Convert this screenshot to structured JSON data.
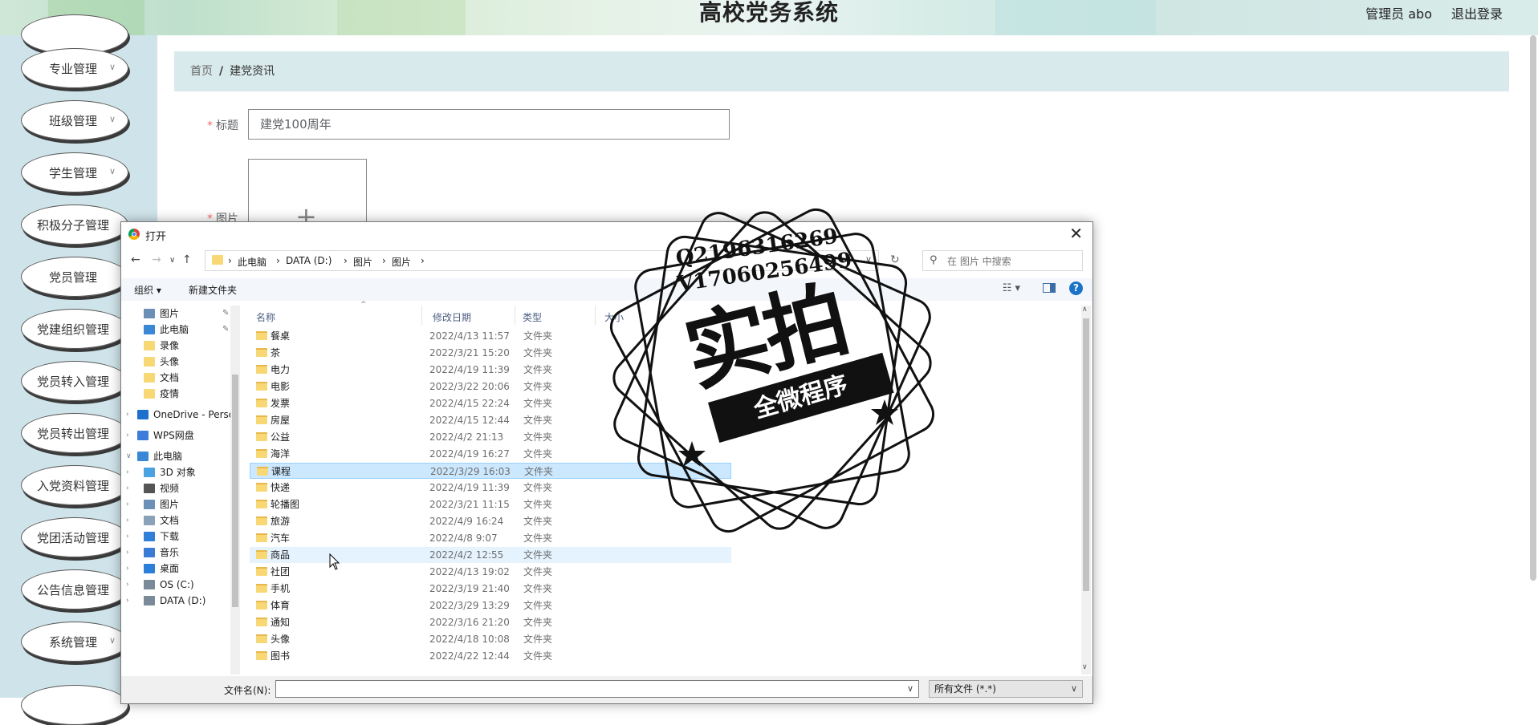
{
  "header": {
    "title": "高校党务系统",
    "user": "管理员 abo",
    "logout": "退出登录"
  },
  "sidebar": {
    "items": [
      {
        "label": "专业管理"
      },
      {
        "label": "班级管理"
      },
      {
        "label": "学生管理"
      },
      {
        "label": "积极分子管理"
      },
      {
        "label": "党员管理"
      },
      {
        "label": "党建组织管理"
      },
      {
        "label": "党员转入管理"
      },
      {
        "label": "党员转出管理"
      },
      {
        "label": "入党资料管理"
      },
      {
        "label": "党团活动管理"
      },
      {
        "label": "公告信息管理"
      },
      {
        "label": "系统管理"
      }
    ]
  },
  "breadcrumb": {
    "home": "首页",
    "separator": "/",
    "current": "建党资讯"
  },
  "form": {
    "title_label": "标题",
    "title_value": "建党100周年",
    "image_label": "图片",
    "required_mark": "*",
    "upload_plus": "+"
  },
  "dialog": {
    "title": "打开",
    "close": "✕",
    "path": [
      "此电脑",
      "DATA (D:)",
      "图片",
      "图片"
    ],
    "search_placeholder": "在 图片 中搜索",
    "toolbar": {
      "organize": "组织 ▾",
      "new_folder": "新建文件夹",
      "help": "?"
    },
    "tree": [
      {
        "label": "图片",
        "icon": "pictures-icon",
        "pinned": true
      },
      {
        "label": "此电脑",
        "icon": "computer-icon",
        "pinned": true
      },
      {
        "label": "录像",
        "icon": "folder-icon"
      },
      {
        "label": "头像",
        "icon": "folder-icon"
      },
      {
        "label": "文档",
        "icon": "folder-icon"
      },
      {
        "label": "疫情",
        "icon": "folder-icon"
      },
      {
        "label": "OneDrive - Perso",
        "icon": "onedrive-icon"
      },
      {
        "label": "WPS网盘",
        "icon": "cloud-icon"
      },
      {
        "label": "此电脑",
        "icon": "computer-icon"
      },
      {
        "label": "3D 对象",
        "icon": "cube-icon"
      },
      {
        "label": "视频",
        "icon": "video-icon"
      },
      {
        "label": "图片",
        "icon": "pictures-icon"
      },
      {
        "label": "文档",
        "icon": "document-icon"
      },
      {
        "label": "下载",
        "icon": "download-icon"
      },
      {
        "label": "音乐",
        "icon": "music-icon"
      },
      {
        "label": "桌面",
        "icon": "desktop-icon"
      },
      {
        "label": "OS (C:)",
        "icon": "drive-icon"
      },
      {
        "label": "DATA (D:)",
        "icon": "drive-icon"
      }
    ],
    "columns": {
      "name": "名称",
      "date": "修改日期",
      "type": "类型",
      "size": "大小"
    },
    "files": [
      {
        "name": "餐桌",
        "date": "2022/4/13 11:57",
        "type": "文件夹"
      },
      {
        "name": "茶",
        "date": "2022/3/21 15:20",
        "type": "文件夹"
      },
      {
        "name": "电力",
        "date": "2022/4/19 11:39",
        "type": "文件夹"
      },
      {
        "name": "电影",
        "date": "2022/3/22 20:06",
        "type": "文件夹"
      },
      {
        "name": "发票",
        "date": "2022/4/15 22:24",
        "type": "文件夹"
      },
      {
        "name": "房屋",
        "date": "2022/4/15 12:44",
        "type": "文件夹"
      },
      {
        "name": "公益",
        "date": "2022/4/2 21:13",
        "type": "文件夹"
      },
      {
        "name": "海洋",
        "date": "2022/4/19 16:27",
        "type": "文件夹"
      },
      {
        "name": "课程",
        "date": "2022/3/29 16:03",
        "type": "文件夹"
      },
      {
        "name": "快递",
        "date": "2022/4/19 11:39",
        "type": "文件夹"
      },
      {
        "name": "轮播图",
        "date": "2022/3/21 11:15",
        "type": "文件夹"
      },
      {
        "name": "旅游",
        "date": "2022/4/9 16:24",
        "type": "文件夹"
      },
      {
        "name": "汽车",
        "date": "2022/4/8 9:07",
        "type": "文件夹"
      },
      {
        "name": "商品",
        "date": "2022/4/2 12:55",
        "type": "文件夹"
      },
      {
        "name": "社团",
        "date": "2022/4/13 19:02",
        "type": "文件夹"
      },
      {
        "name": "手机",
        "date": "2022/3/19 21:40",
        "type": "文件夹"
      },
      {
        "name": "体育",
        "date": "2022/3/29 13:29",
        "type": "文件夹"
      },
      {
        "name": "通知",
        "date": "2022/3/16 21:20",
        "type": "文件夹"
      },
      {
        "name": "头像",
        "date": "2022/4/18 10:08",
        "type": "文件夹"
      },
      {
        "name": "图书",
        "date": "2022/4/22 12:44",
        "type": "文件夹"
      }
    ],
    "selected_file": "课程",
    "hovered_file": "商品",
    "filename_label": "文件名(N):",
    "filename_value": "",
    "filetype": "所有文件 (*.*)"
  },
  "watermark": {
    "line1": "Q2196316269",
    "line2": "V17060256499",
    "big": "实拍",
    "band": "全微程序"
  },
  "colors": {
    "sidebar_bg": "#cfe4ea",
    "breadcrumb_bg": "#d9eaec",
    "selected_row": "#cce8ff",
    "required": "#f56c6c"
  }
}
